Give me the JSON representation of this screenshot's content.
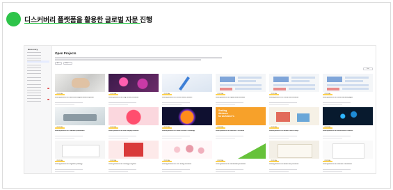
{
  "slide": {
    "title": "디스커버리 플랫폼을 활용한 글로벌 자문 진행",
    "accent_color": "#2ec44a"
  },
  "screenshot": {
    "page_title": "Open Projects",
    "sort_label": "Sort",
    "filters": [
      "All",
      "Filter"
    ],
    "sidebar": {
      "brand": "Discovery",
      "items": [
        "",
        "",
        "",
        "",
        "",
        "",
        "",
        "",
        "",
        "",
        "",
        "",
        "",
        "",
        "",
        "",
        ""
      ]
    },
    "cards": [
      {
        "thumb": "hand",
        "badge": "PROPOSAL",
        "title": "Seeking Advisors for Hand-Held Surgical Robotic Systems"
      },
      {
        "thumb": "beads",
        "badge": "PROPOSAL",
        "title": "Seeking Advisors for Drug Delivery Platforms"
      },
      {
        "thumb": "pen",
        "badge": "PROPOSAL",
        "title": "Seeking Advisors for Insulin Delivery Devices"
      },
      {
        "thumb": "ui",
        "badge": "PROPOSAL",
        "title": "Seeking Advisors for Digital Health Software"
      },
      {
        "thumb": "ui",
        "badge": "PROPOSAL",
        "title": "Seeking Advisors for Clinical Data Platforms"
      },
      {
        "thumb": "ui",
        "badge": "PROPOSAL",
        "title": "Seeking Advisors for Health Monitoring Apps"
      },
      {
        "thumb": "lab",
        "badge": "PROPOSAL",
        "title": "Seeking Advisors for Laboratory Automation"
      },
      {
        "thumb": "brainred",
        "badge": "PROPOSAL",
        "title": "Seeking Advisors for Brain Imaging Research"
      },
      {
        "thumb": "brainfire",
        "badge": "PROPOSAL",
        "title": "Seeking Advisors for Neural Interface Technology"
      },
      {
        "thumb": "orange",
        "badge": "PROPOSAL",
        "title": "Seeking Advisors for Alzheimer's Research",
        "thumb_lines": [
          "Seeking",
          "Advisors",
          "for Alzheimer's"
        ]
      },
      {
        "thumb": "scheme",
        "badge": "PROPOSAL",
        "title": "Seeking Advisors for Medical Device Design"
      },
      {
        "thumb": "neuro",
        "badge": "PROPOSAL",
        "title": "Seeking Advisors for Neuroscience Platforms"
      },
      {
        "thumb": "doc",
        "badge": "PROPOSAL",
        "title": "Seeking Advisors for Regulatory Strategy"
      },
      {
        "thumb": "poster",
        "badge": "PROPOSAL",
        "title": "Seeking Advisors for Oncology Programs"
      },
      {
        "thumb": "cells",
        "badge": "PROPOSAL",
        "title": "Seeking Advisors for Cell Therapy Research"
      },
      {
        "thumb": "green",
        "badge": "PROPOSAL",
        "title": "Seeking Advisors for Sustainability Initiatives"
      },
      {
        "thumb": "book",
        "badge": "PROPOSAL",
        "title": "Seeking Advisors for Market Entry Research"
      },
      {
        "thumb": "paper",
        "badge": "PROPOSAL",
        "title": "Seeking Advisors for Scientific Publications"
      }
    ]
  }
}
